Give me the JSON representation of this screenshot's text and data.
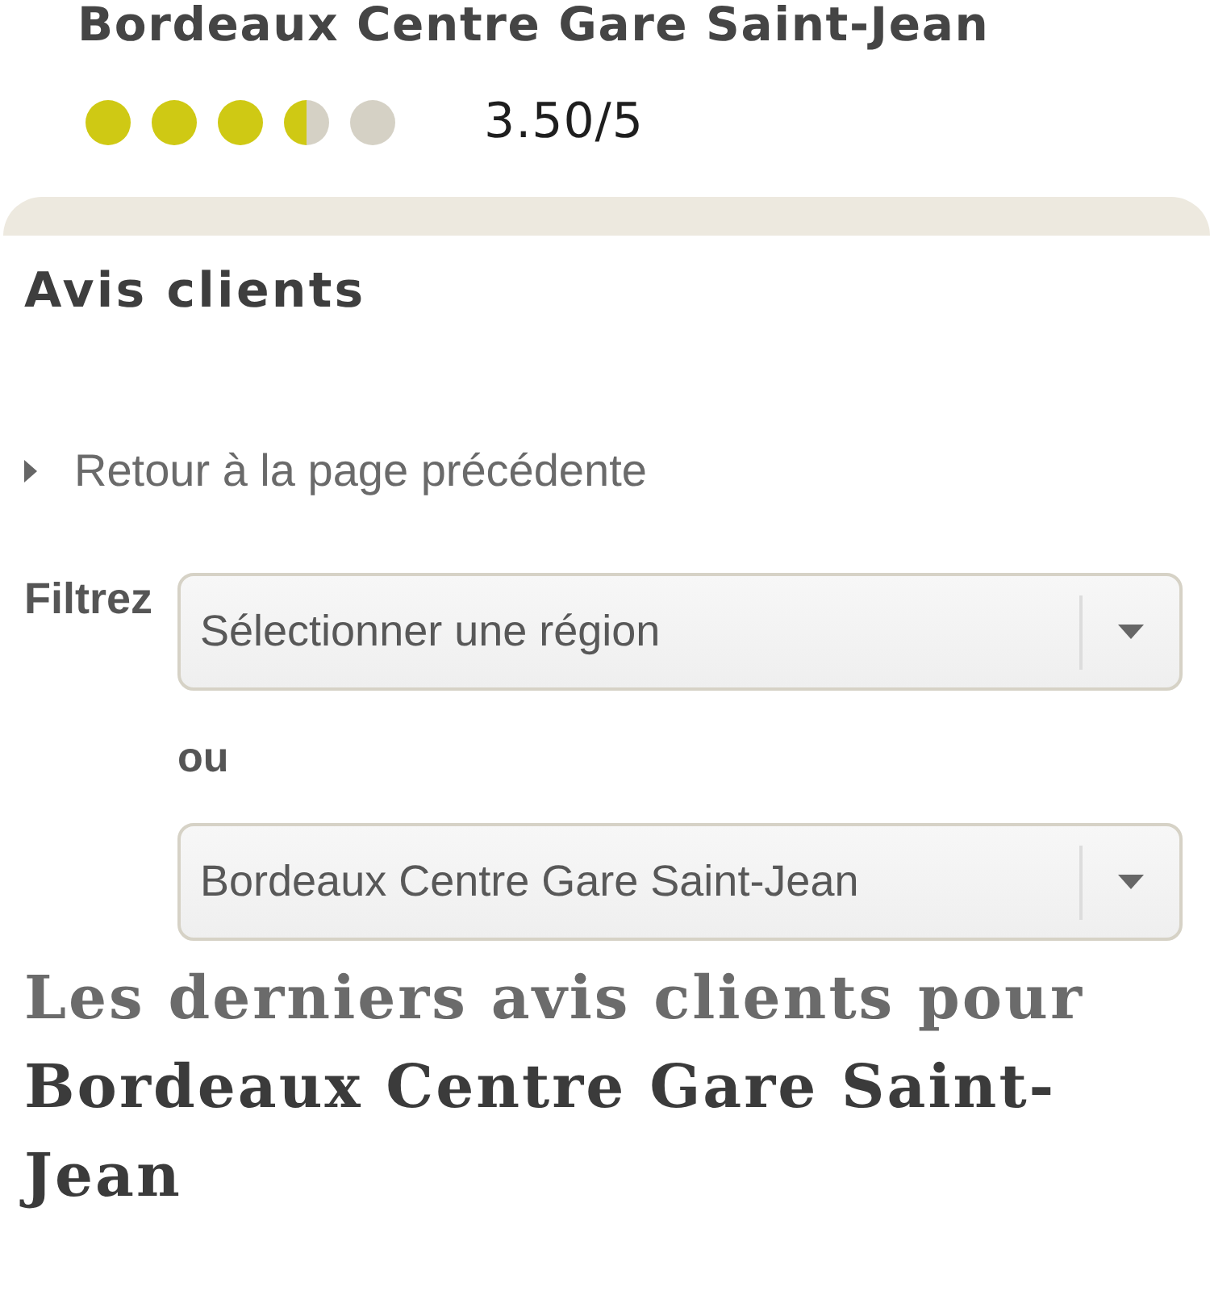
{
  "hotel": {
    "name": "Bordeaux Centre Gare Saint-Jean",
    "stars": 3.5,
    "score": "3.50/5"
  },
  "section": {
    "title": "Avis clients"
  },
  "back_link": {
    "label": "Retour à la page précédente"
  },
  "filters": {
    "label": "Filtrez",
    "separator": "ou",
    "selects": [
      {
        "value": "Sélectionner une région"
      },
      {
        "value": "Bordeaux Centre Gare Saint-Jean"
      }
    ]
  },
  "reviews_heading": "Les derniers avis clients pour **Bordeaux Centre Gare Saint-Jean**"
}
